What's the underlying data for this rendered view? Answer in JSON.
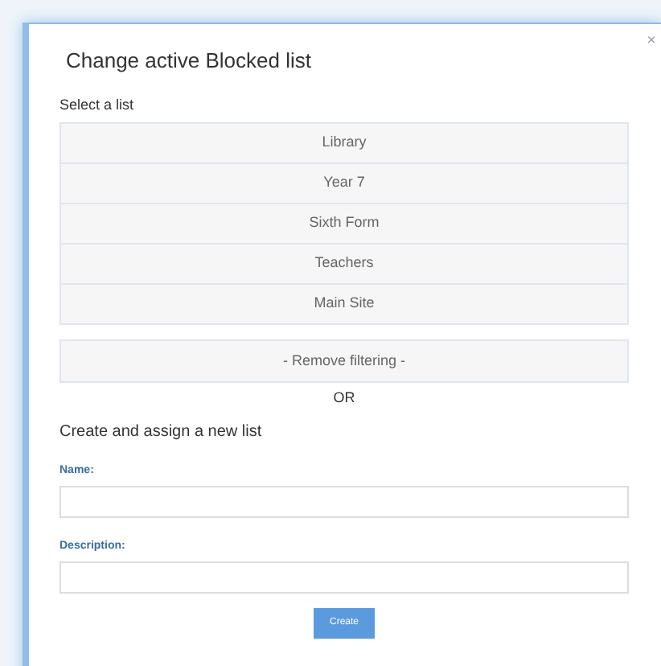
{
  "dialog": {
    "title": "Change active Blocked list",
    "close": "×"
  },
  "select_label": "Select a list",
  "lists": [
    {
      "label": "Library"
    },
    {
      "label": "Year 7"
    },
    {
      "label": "Sixth Form"
    },
    {
      "label": "Teachers"
    },
    {
      "label": "Main Site"
    }
  ],
  "remove_filtering": "- Remove filtering -",
  "separator": "OR",
  "create_heading": "Create and assign a new list",
  "fields": [
    {
      "label": "Name:"
    },
    {
      "label": "Description:"
    }
  ],
  "create_button": "Create"
}
